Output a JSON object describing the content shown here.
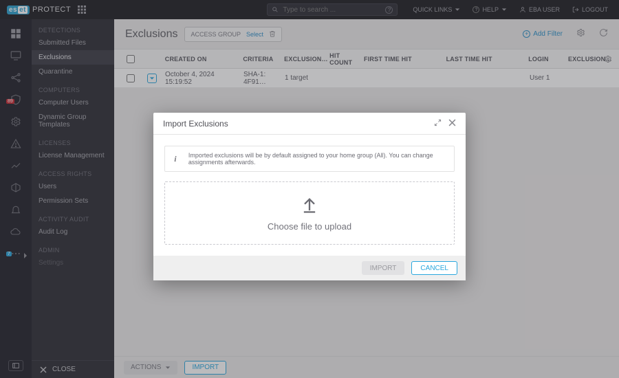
{
  "brand": {
    "badge_left": "es",
    "badge_right": "et",
    "name": "PROTECT"
  },
  "search": {
    "placeholder": "Type to search ..."
  },
  "top": {
    "quick": "QUICK LINKS",
    "help": "HELP",
    "user": "EBA USER",
    "logout": "LOGOUT"
  },
  "sidenav": {
    "detections": "DETECTIONS",
    "submitted": "Submitted Files",
    "exclusions": "Exclusions",
    "quarantine": "Quarantine",
    "computers": "COMPUTERS",
    "computer_users": "Computer Users",
    "dgt": "Dynamic Group Templates",
    "licenses": "LICENSES",
    "lic_mgmt": "License Management",
    "access": "ACCESS RIGHTS",
    "users": "Users",
    "permsets": "Permission Sets",
    "audit": "ACTIVITY AUDIT",
    "audit_log": "Audit Log",
    "admin": "ADMIN",
    "settings": "Settings",
    "close": "CLOSE"
  },
  "rail": {
    "badge_red": "89",
    "badge_blue": "7"
  },
  "header": {
    "title": "Exclusions",
    "access_group": "ACCESS GROUP",
    "select": "Select",
    "add_filter": "Add Filter"
  },
  "columns": {
    "created": "CREATED ON",
    "criteria": "CRITERIA",
    "exclusion": "EXCLUSION…",
    "hit": "HIT COUNT",
    "first": "FIRST TIME HIT",
    "last": "LAST TIME HIT",
    "login": "LOGIN",
    "exclusion2": "EXCLUSION…"
  },
  "row": {
    "created": "October 4, 2024 15:19:52",
    "criteria": "SHA-1: 4F91…",
    "target": "1 target",
    "login": "User 1"
  },
  "footer": {
    "actions": "ACTIONS",
    "import": "IMPORT"
  },
  "modal": {
    "title": "Import Exclusions",
    "info": "Imported exclusions will be by default assigned to your home group (All). You can change assignments afterwards.",
    "choose": "Choose file to upload",
    "import": "IMPORT",
    "cancel": "CANCEL"
  }
}
